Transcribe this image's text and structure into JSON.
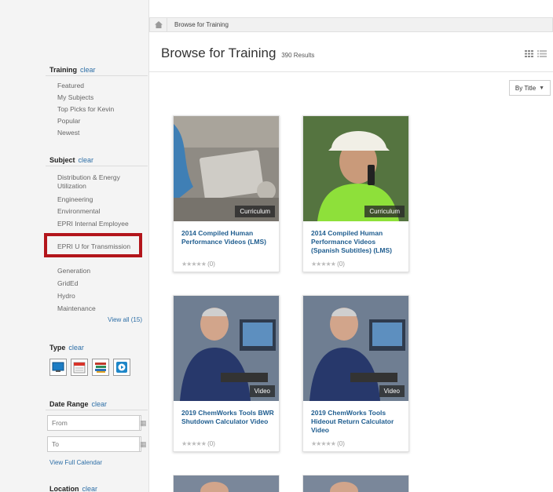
{
  "breadcrumb": {
    "label": "Browse for Training"
  },
  "header": {
    "title": "Browse for Training",
    "results": "390 Results",
    "sort": "By Title"
  },
  "sidebar": {
    "training": {
      "heading": "Training",
      "clear": "clear",
      "items": [
        "Featured",
        "My Subjects",
        "Top Picks for Kevin",
        "Popular",
        "Newest"
      ]
    },
    "subject": {
      "heading": "Subject",
      "clear": "clear",
      "items": [
        "Distribution & Energy Utilization",
        "Engineering",
        "Environmental",
        "EPRI Internal Employee",
        "EPRI U for Transmission",
        "Generation",
        "GridEd",
        "Hydro",
        "Maintenance"
      ],
      "view_all": "View all (15)"
    },
    "type": {
      "heading": "Type",
      "clear": "clear",
      "icons": [
        "online-course-icon",
        "event-icon",
        "curriculum-icon",
        "video-icon"
      ]
    },
    "date_range": {
      "heading": "Date Range",
      "clear": "clear",
      "from_placeholder": "From",
      "to_placeholder": "To",
      "full_calendar": "View Full Calendar"
    },
    "location": {
      "heading": "Location",
      "clear": "clear"
    }
  },
  "cards": [
    {
      "title": "2014 Compiled Human Performance Videos (LMS)",
      "tag": "Curriculum",
      "rating": "(0)"
    },
    {
      "title": "2014 Compiled Human Performance Videos (Spanish Subtitles) (LMS)",
      "tag": "Curriculum",
      "rating": "(0)"
    },
    {
      "title": "2019 ChemWorks Tools BWR Shutdown Calculator Video",
      "tag": "Video",
      "rating": "(0)"
    },
    {
      "title": "2019 ChemWorks Tools Hideout Return Calculator Video",
      "tag": "Video",
      "rating": "(0)"
    }
  ],
  "colors": {
    "link": "#2e6fa7",
    "highlight": "#b3151b"
  }
}
